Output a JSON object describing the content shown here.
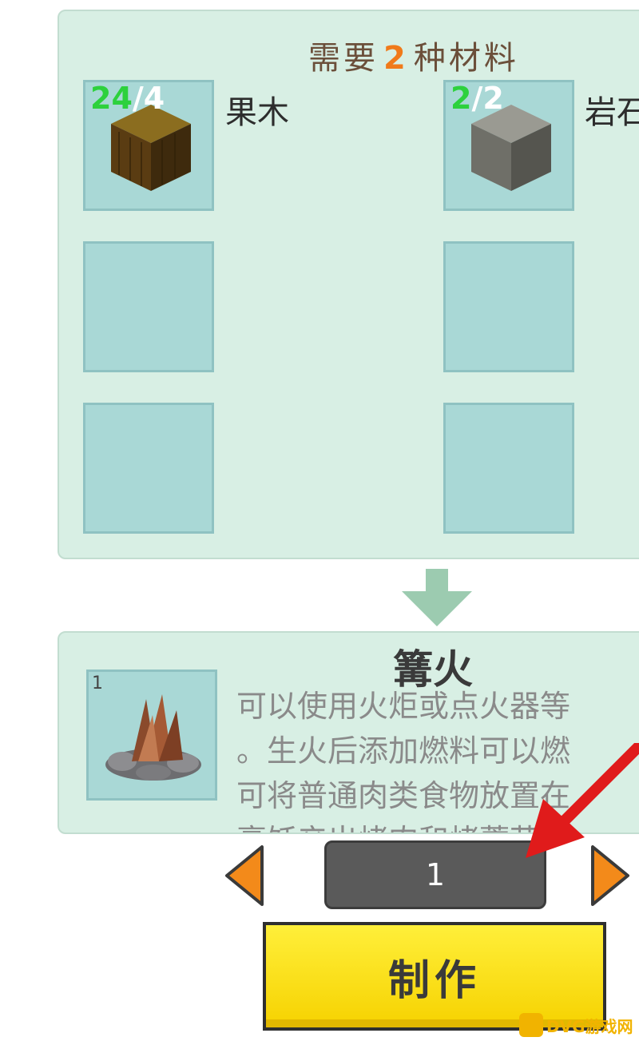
{
  "materials": {
    "title_prefix": "需要",
    "title_count": "2",
    "title_suffix": "种材料",
    "items": [
      {
        "have": "24",
        "need": "/4",
        "name": "果木",
        "icon": "wood-block-icon"
      },
      {
        "have": "2",
        "need": "/2",
        "name": "岩石",
        "icon": "stone-block-icon"
      }
    ]
  },
  "result": {
    "name": "篝火",
    "quantity": "1",
    "icon": "campfire-icon",
    "description_lines": [
      "可以使用火炬或点火器等",
      "。生火后添加燃料可以燃",
      "可将普通肉类食物放置在",
      "烹饪产出烤肉和烤蘑菇"
    ]
  },
  "controls": {
    "quantity": "1",
    "make_label": "制作"
  },
  "watermark": {
    "text": "DVG游戏网"
  },
  "colors": {
    "panel_bg": "#d8efe4",
    "slot_bg": "#a9d8d6",
    "accent_orange": "#f07a1a",
    "have_green": "#2dd13d",
    "button_yellow": "#ffe21a",
    "annotation_red": "#e01b1b"
  }
}
